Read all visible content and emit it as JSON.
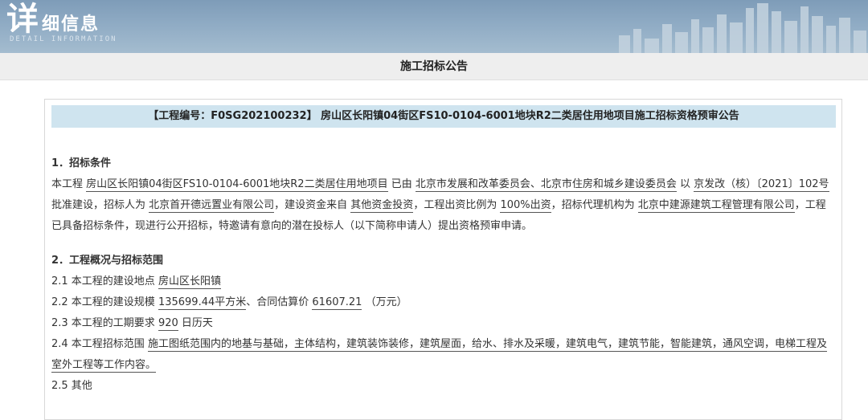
{
  "header": {
    "big_char": "详",
    "rest": "细信息",
    "sub": "DETAIL INFORMATION"
  },
  "subbar": {
    "title": "施工招标公告"
  },
  "notice": {
    "title": "【工程编号：F0SG202100232】    房山区长阳镇04街区FS10-0104-6001地块R2二类居住用地项目施工招标资格预审公告",
    "sec1": {
      "heading": "1．招标条件",
      "t1": "本工程 ",
      "u1": "房山区长阳镇04街区FS10-0104-6001地块R2二类居住用地项目",
      "t2": " 已由 ",
      "u2": "北京市发展和改革委员会、北京市住房和城乡建设委员会",
      "t3": " 以 ",
      "u3": "京发改（核）〔2021〕102号",
      "t4": " 批准建设，招标人为 ",
      "u4": "北京首开德远置业有限公司",
      "t5": "，建设资金来自 ",
      "u5": "其他资金投资",
      "t6": "，工程出资比例为 ",
      "u6": "100%出资",
      "t7": "，招标代理机构为 ",
      "u7": "北京中建源建筑工程管理有限公司",
      "t8": "，工程已具备招标条件，现进行公开招标，特邀请有意向的潜在投标人（以下简称申请人）提出资格预审申请。"
    },
    "sec2": {
      "heading": "2．工程概况与招标范围",
      "l1_label": "2.1 本工程的建设地点 ",
      "l1_val": "房山区长阳镇",
      "l2_label": "2.2 本工程的建设规模 ",
      "l2_val1": "135699.44平方米",
      "l2_mid": "、合同估算价 ",
      "l2_val2": "61607.21",
      "l2_end": " （万元）",
      "l3_label": "2.3 本工程的工期要求 ",
      "l3_val": "920",
      "l3_end": " 日历天",
      "l4_label": "2.4 本工程招标范围 ",
      "l4_val": "施工图纸范围内的地基与基础，主体结构，建筑装饰装修，建筑屋面，给水、排水及采暖，建筑电气，建筑节能，智能建筑，通风空调，电梯工程及室外工程等工作内容。",
      "l5": "2.5 其他"
    }
  }
}
